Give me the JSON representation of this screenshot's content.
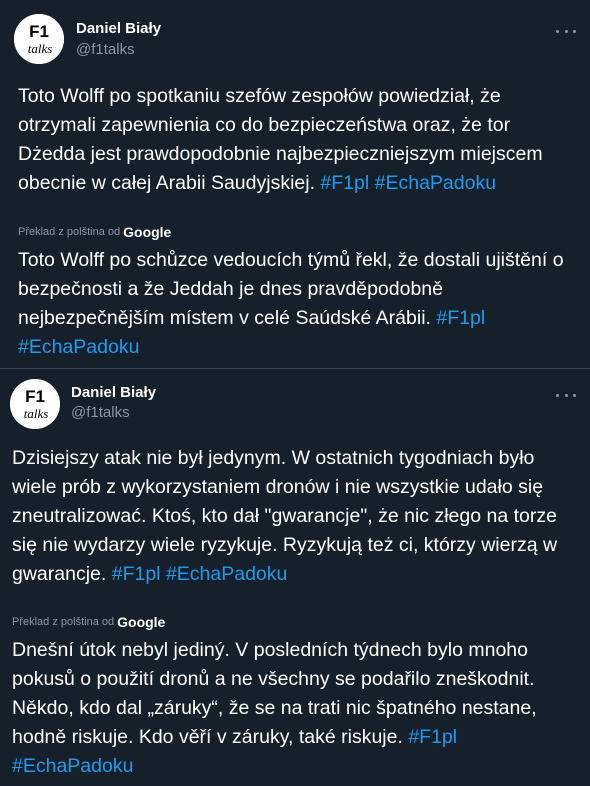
{
  "tweets": [
    {
      "author_name": "Daniel Biały",
      "author_handle": "@f1talks",
      "avatar_logo_line1": "F1",
      "avatar_logo_line2": "talks",
      "text": "Toto Wolff po spotkaniu szefów zespołów powiedział, że otrzymali zapewnienia co do bezpieczeństwa oraz, że tor Dżedda jest prawdopodobnie najbezpieczniejszym miejscem obecnie w całej Arabii Saudyjskiej.",
      "hashtags": [
        "#F1pl",
        "#EchaPadoku"
      ],
      "translation_note": "Překlad z polština od",
      "translation_provider": "Google",
      "translated_text": "Toto Wolff po schůzce vedoucích týmů řekl, že dostali ujištění o bezpečnosti a že Jeddah je dnes pravděpodobně nejbezpečnějším místem v celé Saúdské Arábii.",
      "translated_hashtags": [
        "#F1pl",
        "#EchaPadoku"
      ]
    },
    {
      "author_name": "Daniel Biały",
      "author_handle": "@f1talks",
      "avatar_logo_line1": "F1",
      "avatar_logo_line2": "talks",
      "text": "Dzisiejszy atak nie był jedynym. W ostatnich tygodniach było wiele prób z wykorzystaniem dronów i nie wszystkie udało się zneutralizować. Ktoś, kto dał \"gwarancje\", że nic złego na torze się nie wydarzy wiele ryzykuje. Ryzykują też ci, którzy wierzą w gwarancje.",
      "hashtags": [
        "#F1pl",
        "#EchaPadoku"
      ],
      "translation_note": "Překlad z polština od",
      "translation_provider": "Google",
      "translated_text": "Dnešní útok nebyl jediný. V posledních týdnech bylo mnoho pokusů o použití dronů a ne všechny se podařilo zneškodnit. Někdo, kdo dal „záruky“, že se na trati nic špatného nestane, hodně riskuje. Kdo věří v záruky, také riskuje.",
      "translated_hashtags": [
        "#F1pl",
        "#EchaPadoku"
      ]
    }
  ],
  "colors": {
    "background": "#15202b",
    "text": "#ffffff",
    "secondary": "#8b98a5",
    "link": "#1d9bf0",
    "divider": "#38444d"
  }
}
